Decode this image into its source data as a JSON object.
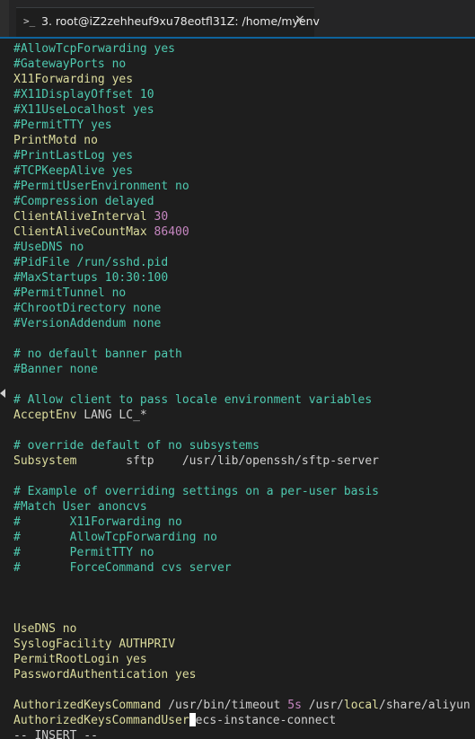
{
  "tab": {
    "icon": ">_",
    "title": "3. root@iZ2zehheuf9xu78eotfl31Z: /home/myenv",
    "close": "×"
  },
  "colors": {
    "comment": "#4ec9b0",
    "keyword": "#dcdc9d",
    "value": "#cfcfcf",
    "number": "#c586c0",
    "accent": "#0e639c",
    "background": "#1e1e1e"
  },
  "lines": [
    [
      {
        "t": "#AllowTcpForwarding yes",
        "c": "c"
      }
    ],
    [
      {
        "t": "#GatewayPorts no",
        "c": "c"
      }
    ],
    [
      {
        "t": "X11Forwarding ",
        "c": "k"
      },
      {
        "t": "yes",
        "c": "k"
      }
    ],
    [
      {
        "t": "#X11DisplayOffset 10",
        "c": "c"
      }
    ],
    [
      {
        "t": "#X11UseLocalhost yes",
        "c": "c"
      }
    ],
    [
      {
        "t": "#PermitTTY yes",
        "c": "c"
      }
    ],
    [
      {
        "t": "PrintMotd ",
        "c": "k"
      },
      {
        "t": "no",
        "c": "k"
      }
    ],
    [
      {
        "t": "#PrintLastLog yes",
        "c": "c"
      }
    ],
    [
      {
        "t": "#TCPKeepAlive yes",
        "c": "c"
      }
    ],
    [
      {
        "t": "#PermitUserEnvironment no",
        "c": "c"
      }
    ],
    [
      {
        "t": "#Compression delayed",
        "c": "c"
      }
    ],
    [
      {
        "t": "ClientAliveInterval ",
        "c": "k"
      },
      {
        "t": "30",
        "c": "m"
      }
    ],
    [
      {
        "t": "ClientAliveCountMax ",
        "c": "k"
      },
      {
        "t": "86400",
        "c": "m"
      }
    ],
    [
      {
        "t": "#UseDNS no",
        "c": "c"
      }
    ],
    [
      {
        "t": "#PidFile /run/sshd.pid",
        "c": "c"
      }
    ],
    [
      {
        "t": "#MaxStartups 10:30:100",
        "c": "c"
      }
    ],
    [
      {
        "t": "#PermitTunnel no",
        "c": "c"
      }
    ],
    [
      {
        "t": "#ChrootDirectory none",
        "c": "c"
      }
    ],
    [
      {
        "t": "#VersionAddendum none",
        "c": "c"
      }
    ],
    [],
    [
      {
        "t": "# no default banner path",
        "c": "c"
      }
    ],
    [
      {
        "t": "#Banner none",
        "c": "c"
      }
    ],
    [],
    [
      {
        "t": "# Allow client to pass locale environment variables",
        "c": "c"
      }
    ],
    [
      {
        "t": "AcceptEnv ",
        "c": "k"
      },
      {
        "t": "LANG LC_*",
        "c": "v"
      }
    ],
    [],
    [
      {
        "t": "# override default of no subsystems",
        "c": "c"
      }
    ],
    [
      {
        "t": "Subsystem       ",
        "c": "k"
      },
      {
        "t": "sftp    /usr/lib/openssh/sftp-server",
        "c": "v"
      }
    ],
    [],
    [
      {
        "t": "# Example of overriding settings on a per-user basis",
        "c": "c"
      }
    ],
    [
      {
        "t": "#Match User anoncvs",
        "c": "c"
      }
    ],
    [
      {
        "t": "#       X11Forwarding no",
        "c": "c"
      }
    ],
    [
      {
        "t": "#       AllowTcpForwarding no",
        "c": "c"
      }
    ],
    [
      {
        "t": "#       PermitTTY no",
        "c": "c"
      }
    ],
    [
      {
        "t": "#       ForceCommand cvs server",
        "c": "c"
      }
    ],
    [],
    [],
    [],
    [
      {
        "t": "UseDNS ",
        "c": "k"
      },
      {
        "t": "no",
        "c": "k"
      }
    ],
    [
      {
        "t": "SyslogFacility ",
        "c": "k"
      },
      {
        "t": "AUTHPRIV",
        "c": "k"
      }
    ],
    [
      {
        "t": "PermitRootLogin ",
        "c": "k"
      },
      {
        "t": "yes",
        "c": "k"
      }
    ],
    [
      {
        "t": "PasswordAuthentication ",
        "c": "k"
      },
      {
        "t": "yes",
        "c": "k"
      }
    ],
    [],
    [
      {
        "t": "AuthorizedKeysCommand ",
        "c": "k"
      },
      {
        "t": "/usr/bin/timeout ",
        "c": "v"
      },
      {
        "t": "5s",
        "c": "m"
      },
      {
        "t": " /usr/",
        "c": "v"
      },
      {
        "t": "local",
        "c": "k"
      },
      {
        "t": "/share/aliyun",
        "c": "v"
      }
    ],
    [
      {
        "t": "AuthorizedKeysCommandUser",
        "c": "k"
      },
      {
        "t": "",
        "c": "cursor"
      },
      {
        "t": "ecs-instance-connect",
        "c": "v"
      }
    ],
    [
      {
        "t": "-- INSERT --",
        "c": "v"
      }
    ]
  ],
  "gutter_markers": [
    23
  ]
}
